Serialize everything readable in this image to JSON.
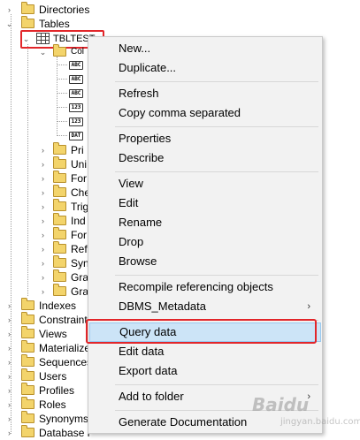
{
  "tree": {
    "top_items": [
      "Directories",
      "Tables"
    ],
    "table_name": "TBLTEST",
    "columns_folder": "Col",
    "column_types": [
      "ABC",
      "ABC",
      "ABC",
      "123",
      "123",
      "DAT"
    ],
    "table_children": [
      "Pri",
      "Uni",
      "For",
      "Che",
      "Trig",
      "Ind",
      "For",
      "Ref",
      "Syn",
      "Gra",
      "Gra"
    ],
    "bottom_items": [
      "Indexes",
      "Constraint",
      "Views",
      "Materialize",
      "Sequences",
      "Users",
      "Profiles",
      "Roles",
      "Synonyms",
      "Database l"
    ]
  },
  "context_menu": {
    "items": {
      "new": "New...",
      "duplicate": "Duplicate...",
      "refresh": "Refresh",
      "copy_comma": "Copy comma separated",
      "properties": "Properties",
      "describe": "Describe",
      "view": "View",
      "edit": "Edit",
      "rename": "Rename",
      "drop": "Drop",
      "browse": "Browse",
      "recompile": "Recompile referencing objects",
      "dbms_metadata": "DBMS_Metadata",
      "query_data": "Query data",
      "edit_data": "Edit data",
      "export_data": "Export data",
      "add_to_folder": "Add to folder",
      "generate_doc": "Generate Documentation"
    },
    "submenu_arrow": "›",
    "highlighted": "Query data"
  },
  "watermark": {
    "text": "Baidu",
    "sub": "jingyan.baidu.com"
  },
  "colors": {
    "annotation_red": "#e2262a",
    "menu_highlight": "#cce4f7",
    "folder_yellow": "#f3d46b"
  }
}
